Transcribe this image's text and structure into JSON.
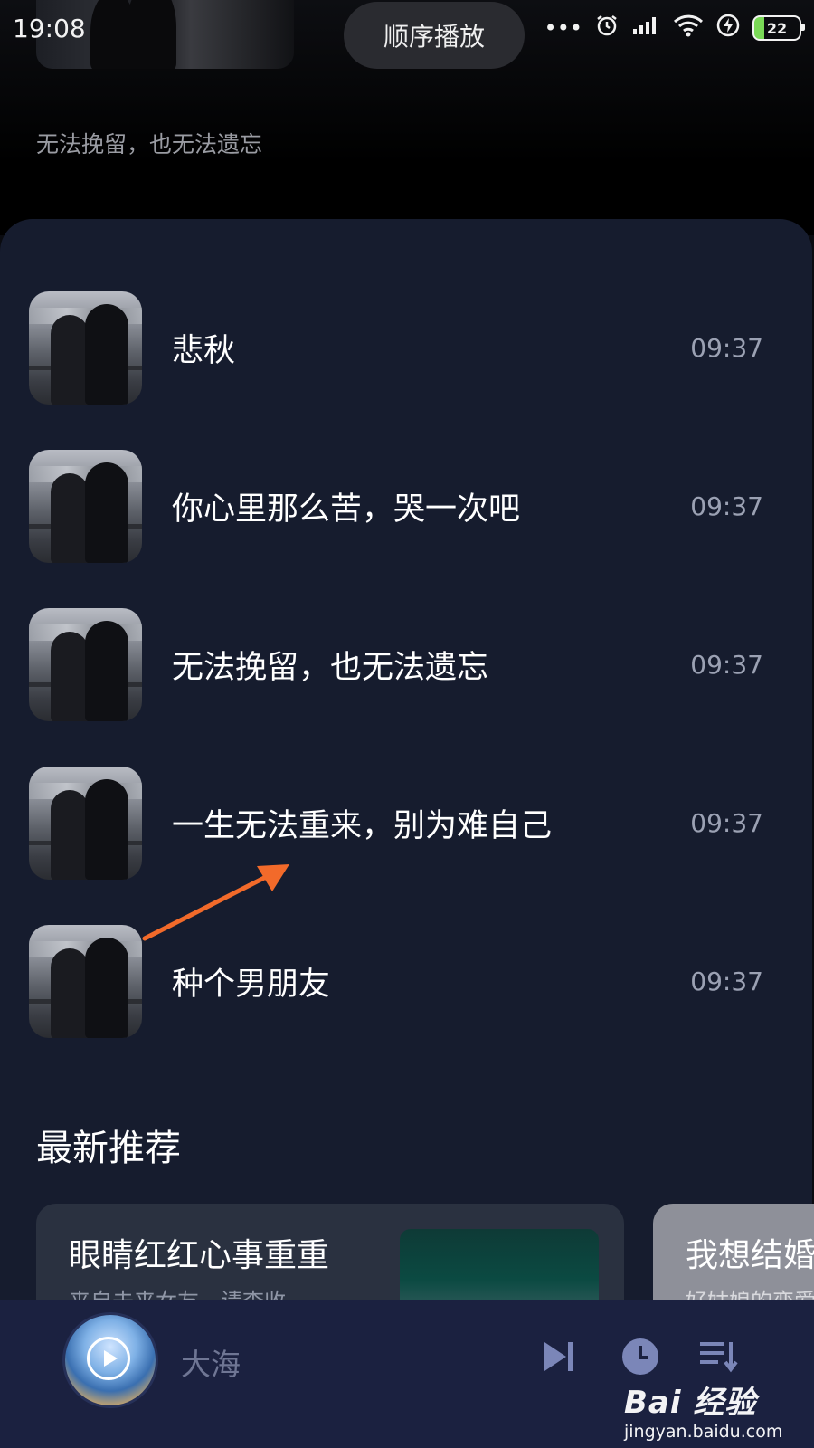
{
  "status_bar": {
    "time": "19:08",
    "battery": "22"
  },
  "header": {
    "play_mode": "顺序播放",
    "subtitle": "无法挽留，也无法遗忘"
  },
  "songs": [
    {
      "title": "悲秋",
      "duration": "09:37"
    },
    {
      "title": "你心里那么苦，哭一次吧",
      "duration": "09:37"
    },
    {
      "title": "无法挽留，也无法遗忘",
      "duration": "09:37"
    },
    {
      "title": "一生无法重来，别为难自己",
      "duration": "09:37"
    },
    {
      "title": "种个男朋友",
      "duration": "09:37"
    }
  ],
  "recommend": {
    "heading": "最新推荐",
    "cards": [
      {
        "title": "眼睛红红心事重重",
        "subtitle": "来自未来女友，请查收"
      },
      {
        "title": "我想结婚",
        "subtitle": "好姑娘的恋爱"
      }
    ]
  },
  "player": {
    "now_playing": "大海"
  },
  "watermark": {
    "logo": "Bai 经验",
    "url": "jingyan.baidu.com"
  },
  "colors": {
    "sheet_bg": "#161c2e",
    "player_bg": "#1b2140",
    "annotation_arrow": "#f26a2a"
  }
}
